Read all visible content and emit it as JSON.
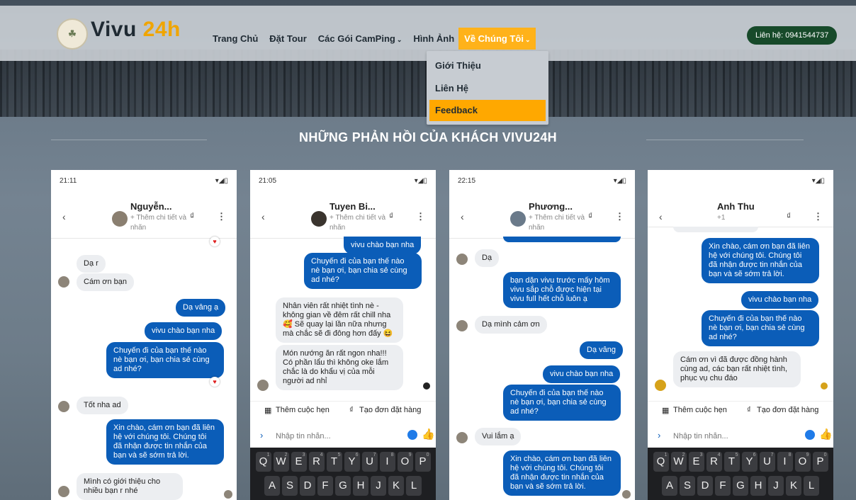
{
  "nav": {
    "brand_part1": "Vivu ",
    "brand_part2": "24h",
    "items": [
      "Trang Chủ",
      "Đặt Tour",
      "Các Gói CamPing",
      "Hình Ảnh",
      "Về Chúng Tôi"
    ],
    "contact": "Liên hệ: 0941544737",
    "dropdown": [
      "Giới Thiệu",
      "Liên Hệ",
      "Feedback"
    ]
  },
  "section_title": "NHỮNG PHẢN HỒI CỦA KHÁCH VIVU24H",
  "phones": [
    {
      "time": "21:11",
      "name": "Nguyễn...",
      "sub": "+ Thêm chi tiết và nhãn",
      "messages": [
        "Dạ r",
        "Cám ơn bạn",
        "Dạ vâng ạ",
        "vivu chào bạn nha",
        "Chuyến đi của bạn thế nào nè bạn ơi, bạn chia sẻ cùng ad nhé?",
        "Tốt nha ad",
        "Xin chào, cám ơn bạn đã liên hệ với chúng tôi. Chúng tôi đã nhận được tin nhắn của bạn và sẽ sớm trả lời.",
        "Mình có giới thiệu cho nhiều bạn r nhé"
      ]
    },
    {
      "time": "21:05",
      "name": "Tuyen Bi...",
      "sub": "+ Thêm chi tiết và nhãn",
      "messages": [
        "vivu chào bạn nha",
        "Chuyến đi của bạn thế nào nè bạn ơi, bạn chia sẻ cùng ad nhé?",
        "Nhân viên rất nhiệt tình nè - không gian về đêm rất chill nha 🥰 Sẽ quay lại lần nữa nhưng mà chắc sẽ đi đông hơn đấy 😆",
        "Món nướng ăn rất ngon nha!!! Có phần lẩu thì không oke lắm chắc là do khẩu vị của mỗi người ad nhỉ"
      ],
      "actions": [
        "Thêm cuộc hẹn",
        "Tạo đơn đặt hàng"
      ],
      "placeholder": "Nhập tin nhắn...",
      "keys1": [
        "Q",
        "W",
        "E",
        "R",
        "T",
        "Y",
        "U",
        "I",
        "O",
        "P"
      ],
      "nums": [
        "1",
        "2",
        "3",
        "4",
        "5",
        "6",
        "7",
        "8",
        "9",
        "0"
      ],
      "keys2": [
        "A",
        "S",
        "D",
        "F",
        "G",
        "H",
        "J",
        "K",
        "L"
      ]
    },
    {
      "time": "22:15",
      "name": "Phương...",
      "sub": "+ Thêm chi tiết và nhãn",
      "messages": [
        "Dạ",
        "bạn dặn vivu trước mấy hôm vivu sắp chỗ được hiện tại vivu full hết chỗ luôn ạ",
        "Dạ mình cảm ơn",
        "Dạ vâng",
        "vivu chào bạn nha",
        "Chuyến đi của bạn thế nào nè bạn ơi, bạn chia sẻ cùng ad nhé?",
        "Vui lắm ạ",
        "Xin chào, cám ơn bạn đã liên hệ với chúng tôi. Chúng tôi đã nhận được tin nhắn của bạn và sẽ sớm trả lời."
      ]
    },
    {
      "name": "Anh Thu",
      "sub": "+1",
      "messages": [
        "Xin chào, cám ơn bạn đã liên hệ với chúng tôi. Chúng tôi đã nhận được tin nhắn của bạn và sẽ sớm trả lời.",
        "vivu chào bạn nha",
        "Chuyến đi của bạn thế nào nè bạn ơi, bạn chia sẻ cùng ad nhé?",
        "Cám ơn vì đã được đồng hành cùng ad, các bạn rất nhiệt tình, phục vụ chu đáo"
      ],
      "actions": [
        "Thêm cuộc hẹn",
        "Tạo đơn đặt hàng"
      ],
      "placeholder": "Nhập tin nhắn..."
    }
  ],
  "colors": {
    "accent": "#ffb21a",
    "contact_bg": "#174a2a",
    "bubble_out": "#0b5db8",
    "bubble_in": "#eceef1"
  }
}
